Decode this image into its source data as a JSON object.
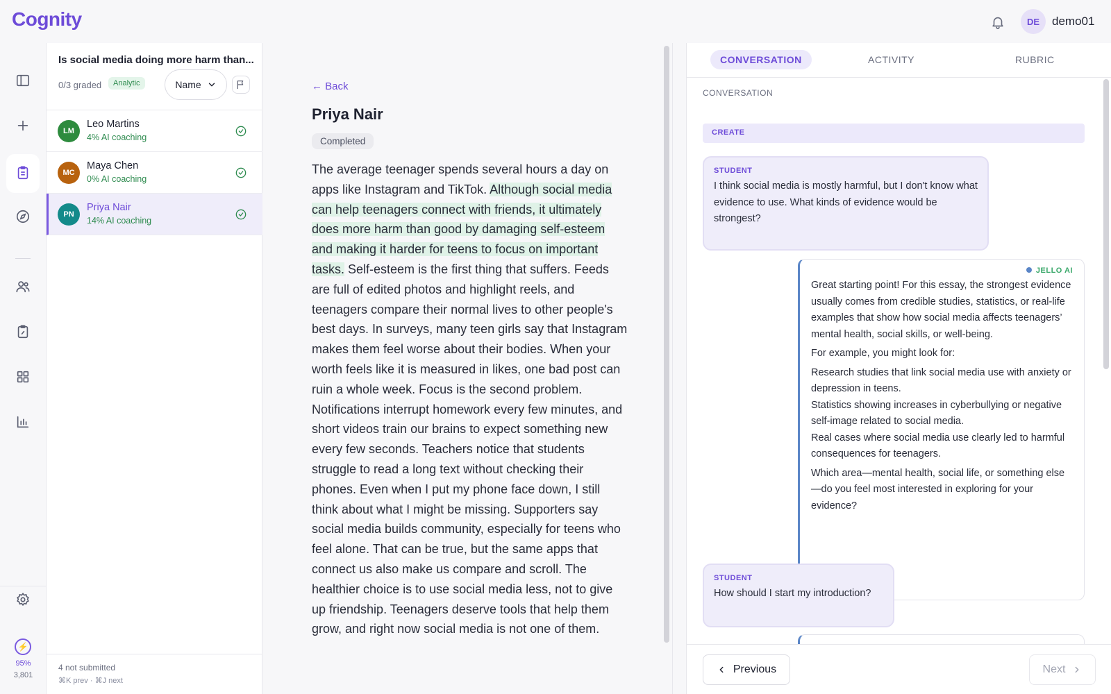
{
  "app": {
    "logo": "Cognity"
  },
  "header": {
    "user_initials": "DE",
    "username": "demo01"
  },
  "rail": {
    "items": [
      "sidebar-toggle-icon",
      "plus-icon",
      "clipboard-icon",
      "compass-icon",
      "users-icon",
      "lesson-icon",
      "grid-icon",
      "chart-icon"
    ],
    "settings_icon": "gear-icon",
    "credits_percent": "95%",
    "credits_count": "3,801",
    "credit_icon": "⚡"
  },
  "assignment": {
    "title": "Is social media doing more harm than...",
    "graded": "0/3 graded",
    "rubric_type": "Analytic",
    "sort_label": "Name"
  },
  "students": [
    {
      "initials": "LM",
      "name": "Leo Martins",
      "ai": "4% AI coaching",
      "color": "#2e8b3e"
    },
    {
      "initials": "MC",
      "name": "Maya Chen",
      "ai": "0% AI coaching",
      "color": "#b8620e"
    },
    {
      "initials": "PN",
      "name": "Priya Nair",
      "ai": "14% AI coaching",
      "color": "#138a8a"
    }
  ],
  "list_footer": {
    "not_submitted": "4 not submitted",
    "shortcuts": "⌘K prev · ⌘J next"
  },
  "essay": {
    "back": "← Back",
    "student": "Priya Nair",
    "status": "Completed",
    "text_before": "The average teenager spends several hours a day on apps like Instagram and TikTok. ",
    "text_highlight": "Although social media can help teenagers connect with friends, it ultimately does more harm than good by damaging self-esteem and making it harder for teens to focus on important tasks.",
    "text_after": " Self-esteem is the first thing that suffers. Feeds are full of edited photos and highlight reels, and teenagers compare their normal lives to other people's best days. In surveys, many teen girls say that Instagram makes them feel worse about their bodies. When your worth feels like it is measured in likes, one bad post can ruin a whole week. Focus is the second problem. Notifications interrupt homework every few minutes, and short videos train our brains to expect something new every few seconds. Teachers notice that students struggle to read a long text without checking their phones. Even when I put my phone face down, I still think about what I might be missing. Supporters say social media builds community, especially for teens who feel alone. That can be true, but the same apps that connect us also make us compare and scroll. The healthier choice is to use social media less, not to give up friendship. Teenagers deserve tools that help them grow, and right now social media is not one of them."
  },
  "tabs": {
    "conversation": "CONVERSATION",
    "activity": "ACTIVITY",
    "rubric": "RUBRIC"
  },
  "conversation": {
    "label": "CONVERSATION",
    "stage": "CREATE",
    "msg1": {
      "role": "STUDENT",
      "text": "I think social media is mostly harmful, but I don't know what evidence to use. What kinds of evidence would be strongest?"
    },
    "msg2": {
      "role": "JELLO AI",
      "p1": "Great starting point! For this essay, the strongest evidence usually comes from credible studies, statistics, or real-life examples that show how social media affects teenagers’ mental health, social skills, or well-being.",
      "p2": "For example, you might look for:",
      "p3": "Research studies that link social media use with anxiety or depression in teens.",
      "p4": "Statistics showing increases in cyberbullying or negative self-image related to social media.",
      "p5": "Real cases where social media use clearly led to harmful consequences for teenagers.",
      "p6": "Which area—mental health, social life, or something else—do you feel most interested in exploring for your evidence?"
    },
    "msg3": {
      "role": "STUDENT",
      "text": "How should I start my introduction?"
    }
  },
  "footer": {
    "previous": "Previous",
    "next": "Next"
  },
  "colors": {
    "accent": "#6d4bd8",
    "success": "#2e8b4f",
    "ai_border": "#5b86c7"
  }
}
